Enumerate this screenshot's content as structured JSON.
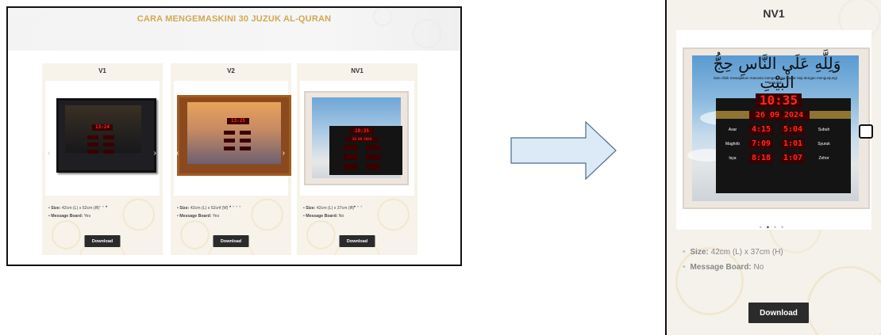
{
  "left": {
    "title": "CARA MENGEMASKINI 30 JUZUK AL-QURAN",
    "cards": [
      {
        "name": "V1",
        "size_label": "Size:",
        "size_value": "42cm (L) x 52cm (H)",
        "board_label": "Message Board:",
        "board_value": "Yes",
        "button": "Download"
      },
      {
        "name": "V2",
        "size_label": "Size:",
        "size_value": "42cm (L) x 52cm (H)",
        "board_label": "Message Board:",
        "board_value": "Yes",
        "button": "Download"
      },
      {
        "name": "NV1",
        "size_label": "Size:",
        "size_value": "42cm (L) x 37cm (H)",
        "board_label": "Message Board:",
        "board_value": "No",
        "button": "Download"
      }
    ]
  },
  "right": {
    "title": "NV1",
    "clock": {
      "time": "10:35",
      "date": "26 09 2024",
      "prayers": [
        {
          "name": "Asar",
          "time": "4:15"
        },
        {
          "name": "Subuh",
          "time": "5:04"
        },
        {
          "name": "Maghrib",
          "time": "7:09"
        },
        {
          "name": "Syuruk",
          "time": "1:01"
        },
        {
          "name": "Isya",
          "time": "8:18"
        },
        {
          "name": "Zohor",
          "time": "1:07"
        }
      ],
      "arabic": "وَلِلَّهِ عَلَى النَّاسِ حِجُّ الْبَيْتِ",
      "caption": "Dan Allah mewajibkan manusia mengerjakan ibadat Haji dengan mengunjungi Baitullah"
    },
    "size_label": "Size:",
    "size_value": "42cm (L) x 37cm (H)",
    "board_label": "Message Board:",
    "board_value": "No",
    "button": "Download",
    "carousel_dots": 4,
    "active_dot": 1
  },
  "colors": {
    "accent_gold": "#d5a84b",
    "button_dark": "#2b2b2b",
    "led_red": "#ff2a1a",
    "arrow_fill": "#dce9f6",
    "arrow_stroke": "#4a6b8a"
  }
}
